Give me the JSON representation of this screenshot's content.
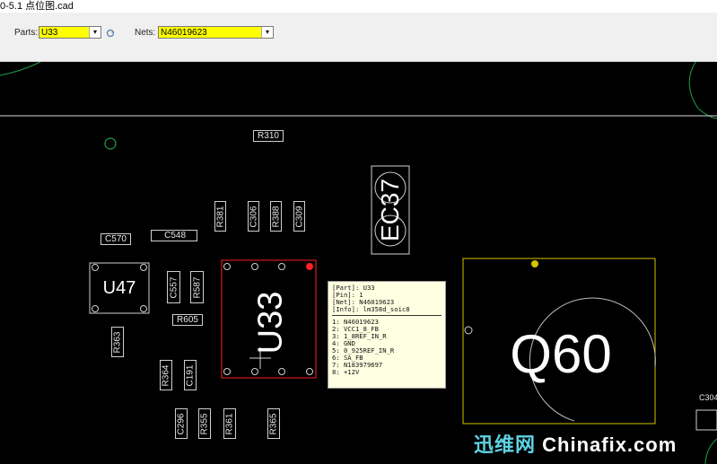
{
  "window": {
    "title": "0-5.1 点位图.cad"
  },
  "toolbar": {
    "parts_label": "Parts:",
    "parts_value": "U33",
    "nets_label": "Nets:",
    "nets_value": "N46019623"
  },
  "parts": {
    "r310": "R310",
    "ec37": "EC37",
    "r381": "R381",
    "c306": "C306",
    "r388": "R388",
    "c309": "C309",
    "c570": "C570",
    "c548": "C548",
    "u47": "U47",
    "c557": "C557",
    "r587": "R587",
    "r605": "R605",
    "r363": "R363",
    "r364": "R364",
    "c191": "C191",
    "c296": "C296",
    "r355": "R355",
    "r361": "R361",
    "r365": "R365",
    "u33": "U33",
    "q60": "Q60",
    "c304": "C304"
  },
  "tooltip": {
    "part": "[Part]: U33",
    "pin": "[Pin]: 1",
    "net": "[Net]: N46019623",
    "info": "[Info]: lm358d_soic8",
    "pins": [
      "1: N46019623",
      "2: VCC1_8_FB",
      "3: 1_8REF_IN_R",
      "4: GND",
      "5: 0_925REF_IN_R",
      "6: SA_FB",
      "7: N183979697",
      "8: +12V"
    ]
  },
  "watermark": {
    "cn": "迅维网",
    "en": "Chinafix.com"
  },
  "colors": {
    "highlight": "#ffff00",
    "selected_part": "#ff2020",
    "q60_outline": "#d4c400",
    "circles": "#1fa04a"
  }
}
